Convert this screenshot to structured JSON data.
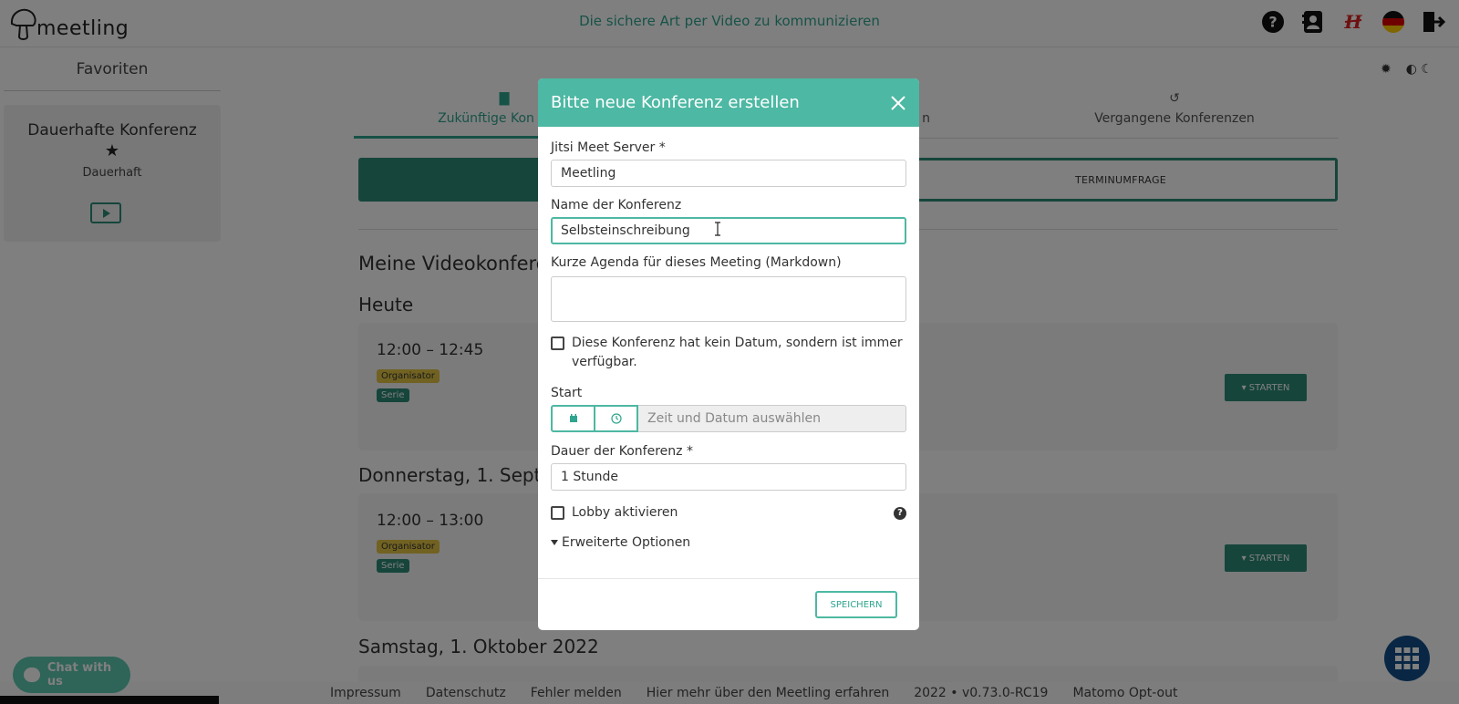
{
  "header": {
    "logo_text": "meetling",
    "tagline": "Die sichere Art per Video zu kommunizieren",
    "icons": [
      "help-icon",
      "contacts-icon",
      "brand-h-icon",
      "german-flag-icon",
      "logout-icon"
    ],
    "accent_color": "#2fa58f"
  },
  "sidebar": {
    "title": "Favoriten",
    "favorite": {
      "title": "Dauerhafte Konferenz",
      "subtitle": "Dauerhaft",
      "icons": [
        "star-icon",
        "play-icon"
      ]
    }
  },
  "main": {
    "tabs": [
      {
        "label": "Zukünftige Kon",
        "icon": "calendar-icon",
        "active": true
      },
      {
        "label": "n",
        "icon": "",
        "active": false
      },
      {
        "label": "Vergangene Konferenzen",
        "icon": "history-icon",
        "active": false
      }
    ],
    "poll_button": "TERMINUMFRAGE",
    "heading": "Meine Videokonfere",
    "days": [
      {
        "label": "Heute",
        "time": "12:00 – 12:45",
        "badges": [
          "Organisator",
          "Serie"
        ],
        "start_label": "▾ STARTEN"
      },
      {
        "label": "Donnerstag, 1. Septe",
        "time": "12:00 – 13:00",
        "badges": [
          "Organisator",
          "Serie"
        ],
        "start_label": "▾ STARTEN"
      },
      {
        "label": "Samstag, 1. Oktober 2022"
      }
    ]
  },
  "footer": {
    "links": [
      "Impressum",
      "Datenschutz",
      "Fehler melden",
      "Hier mehr über den Meetling erfahren",
      "2022 • v0.73.0-RC19",
      "Matomo Opt-out"
    ]
  },
  "chat": {
    "label": "Chat with us"
  },
  "modal": {
    "title": "Bitte neue Konferenz erstellen",
    "server_label": "Jitsi Meet Server *",
    "server_value": "Meetling",
    "name_label": "Name der Konferenz",
    "name_value": "Selbsteinschreibung",
    "agenda_label": "Kurze Agenda für dieses Meeting (Markdown)",
    "agenda_value": "",
    "no_date_label_line1": "Diese Konferenz hat kein Datum, sondern ist immer",
    "no_date_label_line2": "verfügbar.",
    "no_date_checked": false,
    "start_label": "Start",
    "start_placeholder": "Zeit und Datum auswählen",
    "duration_label": "Dauer der Konferenz *",
    "duration_value": "1 Stunde",
    "lobby_label": "Lobby aktivieren",
    "lobby_checked": false,
    "advanced_label": "Erweiterte Optionen",
    "save_label": "SPEICHERN",
    "header_color": "#4db8a3"
  }
}
